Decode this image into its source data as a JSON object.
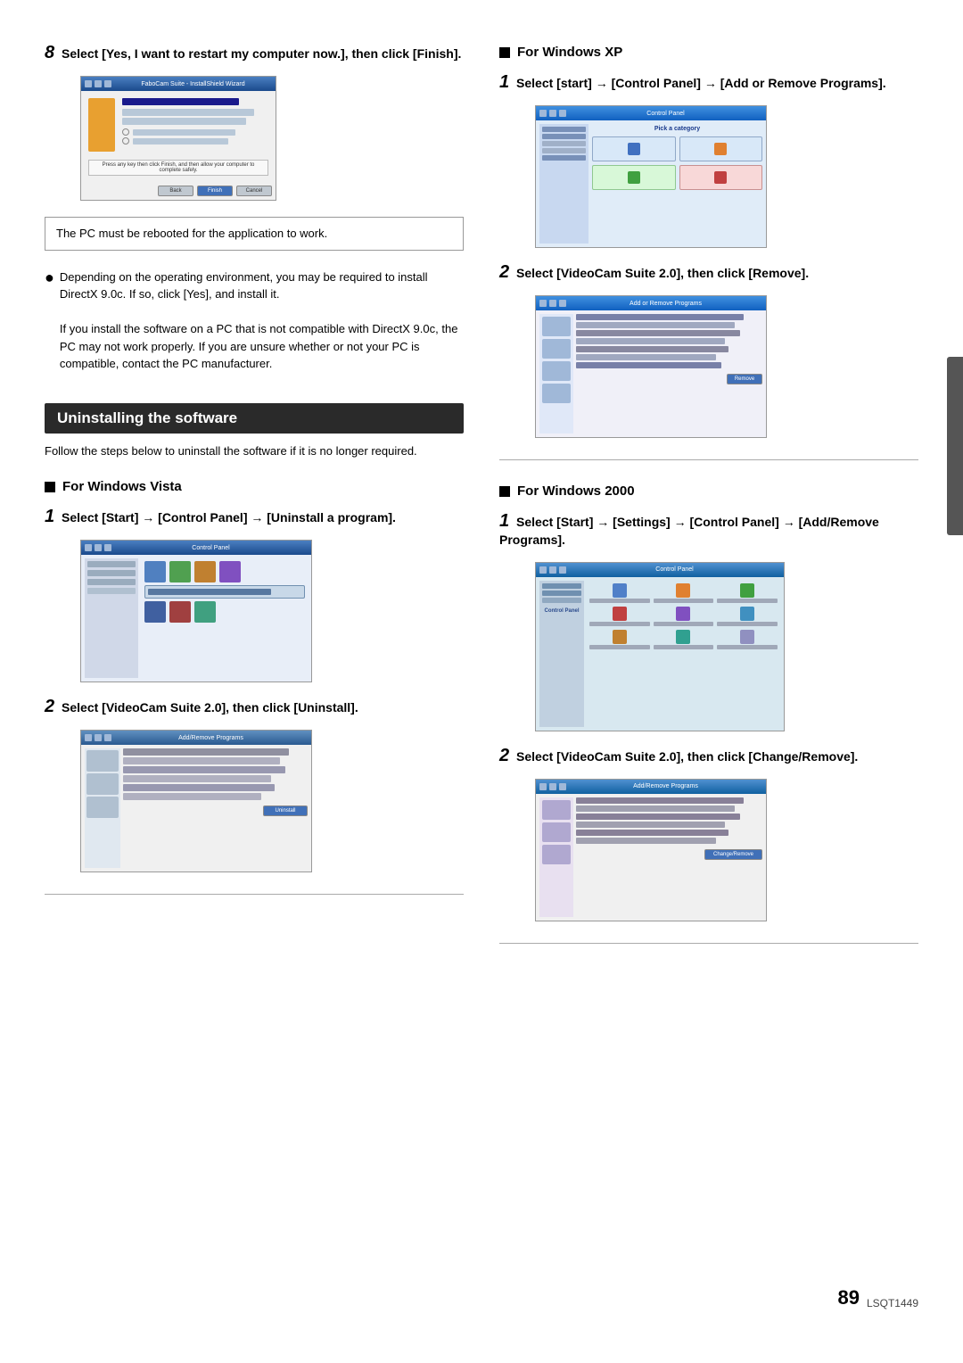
{
  "page": {
    "number": "89",
    "code": "LSQT1449"
  },
  "left_column": {
    "step8": {
      "number": "8",
      "text": "Select [Yes, I want to restart my computer now.], then click [Finish]."
    },
    "note": {
      "text": "The PC must be rebooted for the application to work."
    },
    "bullet": {
      "dot": "●",
      "lines": [
        "Depending on the operating environment, you may be required to install DirectX 9.0c. If so, click [Yes], and install it.",
        "If you install the software on a PC that is not compatible with DirectX 9.0c, the PC may not work properly. If you are unsure whether or not your PC is compatible, contact the PC manufacturer."
      ]
    },
    "banner": "Uninstalling the software",
    "intro": "Follow the steps below to uninstall the software if it is no longer required.",
    "windows_vista": {
      "heading": "For Windows Vista",
      "step1": {
        "number": "1",
        "text": "Select [Start] → [Control Panel] → [Uninstall a program]."
      },
      "step2": {
        "number": "2",
        "text": "Select [VideoCam Suite 2.0], then click [Uninstall]."
      }
    }
  },
  "right_column": {
    "windows_xp": {
      "heading": "For Windows XP",
      "step1": {
        "number": "1",
        "text": "Select [start] → [Control Panel] → [Add or Remove Programs]."
      },
      "step2": {
        "number": "2",
        "text": "Select [VideoCam Suite 2.0], then click [Remove]."
      }
    },
    "windows_2000": {
      "heading": "For Windows 2000",
      "step1": {
        "number": "1",
        "text": "Select [Start] → [Settings] → [Control Panel] → [Add/Remove Programs]."
      },
      "step2": {
        "number": "2",
        "text": "Select [VideoCam Suite 2.0], then click [Change/Remove]."
      }
    }
  },
  "screenshots": {
    "step8_finish": "Install Wizard Complete dialog",
    "vista_control_panel": "Control Panel - Uninstall a program",
    "vista_uninstall": "Programs list with Uninstall button",
    "xp_control_panel": "Pick a category - Add or Remove Programs",
    "xp_remove": "Add or Remove Programs list",
    "win2000_control_panel": "Control Panel - Add/Remove Programs",
    "win2000_change_remove": "Add/Remove Programs list"
  }
}
